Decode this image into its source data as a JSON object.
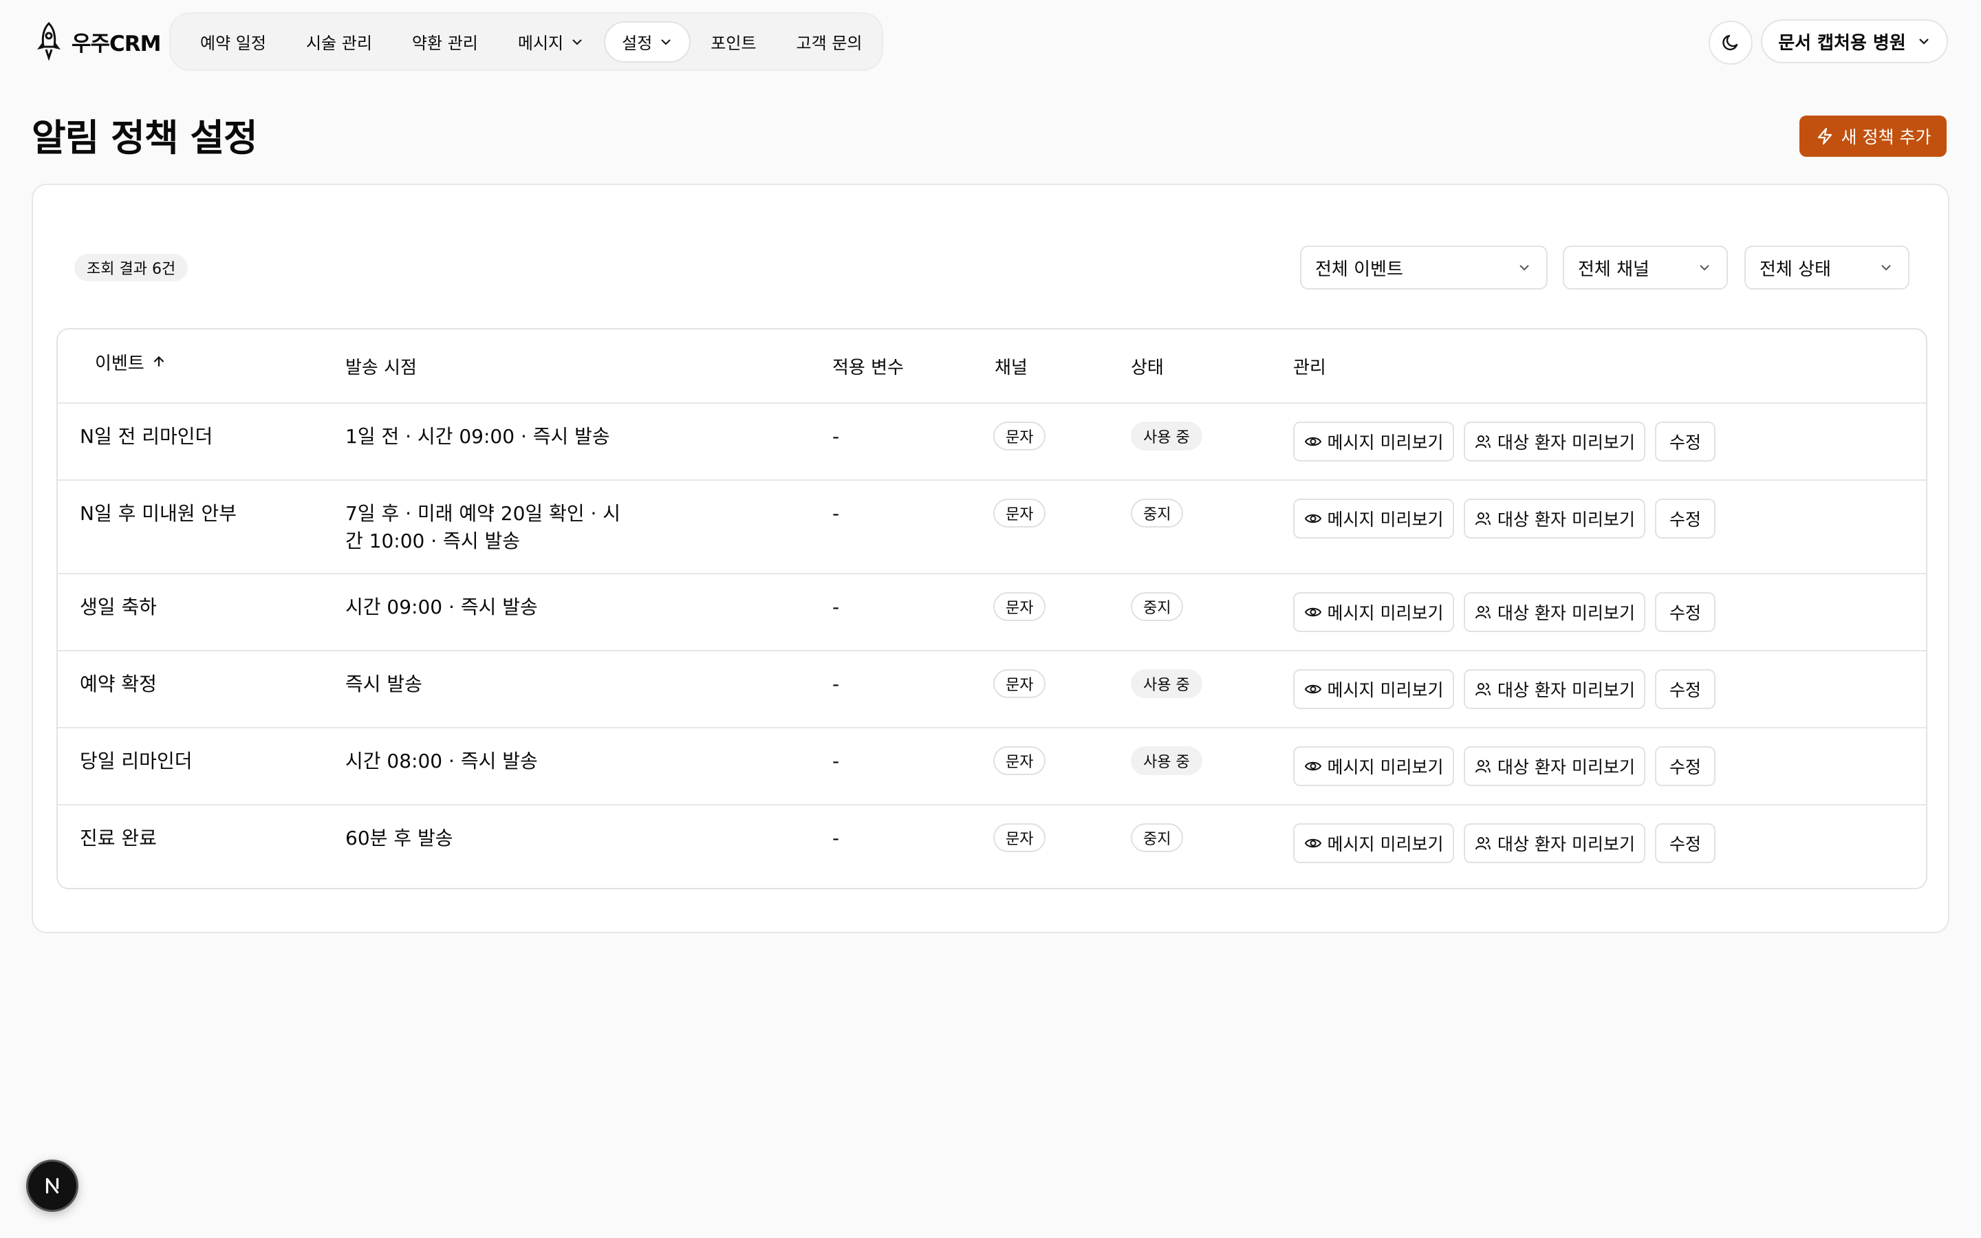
{
  "app": {
    "logo_text": "우주CRM",
    "theme_icon": "moon-icon",
    "hospital_name": "문서 캡처용 병원"
  },
  "nav": {
    "items": [
      {
        "label": "예약 일정"
      },
      {
        "label": "시술 관리"
      },
      {
        "label": "약환 관리"
      },
      {
        "label": "메시지"
      },
      {
        "label": "설정"
      },
      {
        "label": "포인트"
      },
      {
        "label": "고객 문의"
      }
    ]
  },
  "page": {
    "title": "알림 정책 설정",
    "add_button": "새 정책 추가",
    "add_icon": "lightning-icon",
    "accent_color": "#c2510f"
  },
  "filters": {
    "result_count": "조회 결과 6건",
    "event": "전체 이벤트",
    "channel": "전체 채널",
    "status": "전체 상태"
  },
  "table": {
    "headers": {
      "event": "이벤트",
      "timing": "발송 시점",
      "variables": "적용 변수",
      "channel": "채널",
      "status": "상태",
      "manage": "관리"
    },
    "sort_icon": "arrow-up-icon",
    "actions": {
      "preview_message": "메시지 미리보기",
      "preview_patients": "대상 환자 미리보기",
      "edit": "수정"
    },
    "rows": [
      {
        "event": "N일 전 리마인더",
        "timing": "1일 전 · 시간 09:00 · 즉시 발송",
        "variables": "-",
        "channel": "문자",
        "status": "사용 중"
      },
      {
        "event": "N일 후 미내원 안부",
        "timing": "7일 후 · 미래 예약 20일 확인 · 시간 10:00 · 즉시 발송",
        "variables": "-",
        "channel": "문자",
        "status": "중지"
      },
      {
        "event": "생일 축하",
        "timing": "시간 09:00 · 즉시 발송",
        "variables": "-",
        "channel": "문자",
        "status": "중지"
      },
      {
        "event": "예약 확정",
        "timing": "즉시 발송",
        "variables": "-",
        "channel": "문자",
        "status": "사용 중"
      },
      {
        "event": "당일 리마인더",
        "timing": "시간 08:00 · 즉시 발송",
        "variables": "-",
        "channel": "문자",
        "status": "사용 중"
      },
      {
        "event": "진료 완료",
        "timing": "60분 후 발송",
        "variables": "-",
        "channel": "문자",
        "status": "중지"
      }
    ]
  },
  "floating": {
    "badge_letter": "N"
  }
}
